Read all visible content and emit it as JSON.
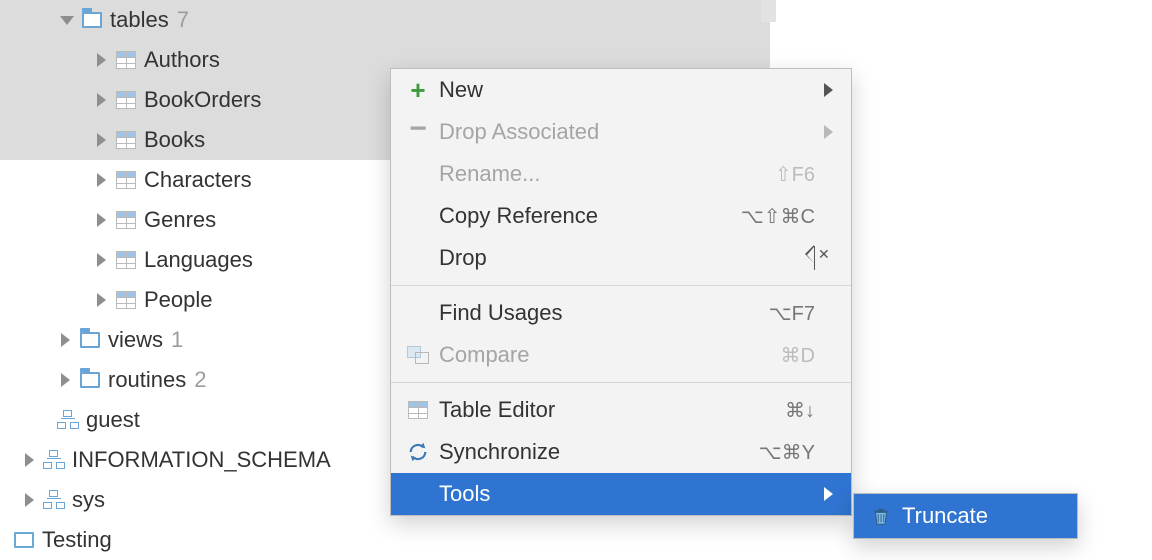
{
  "tree": {
    "tables_folder": {
      "label": "tables",
      "count": "7"
    },
    "items": [
      {
        "label": "Authors"
      },
      {
        "label": "BookOrders"
      },
      {
        "label": "Books"
      },
      {
        "label": "Characters"
      },
      {
        "label": "Genres"
      },
      {
        "label": "Languages"
      },
      {
        "label": "People"
      }
    ],
    "views_folder": {
      "label": "views",
      "count": "1"
    },
    "routines_folder": {
      "label": "routines",
      "count": "2"
    },
    "guest_schema": {
      "label": "guest"
    },
    "info_schema": {
      "label": "INFORMATION_SCHEMA"
    },
    "sys_schema": {
      "label": "sys"
    },
    "datasource": {
      "label": "Testing"
    }
  },
  "menu": {
    "new": {
      "label": "New"
    },
    "drop_assoc": {
      "label": "Drop Associated"
    },
    "rename": {
      "label": "Rename...",
      "accel": "⇧F6"
    },
    "copy_ref": {
      "label": "Copy Reference",
      "accel": "⌥⇧⌘C"
    },
    "drop": {
      "label": "Drop"
    },
    "find_usages": {
      "label": "Find Usages",
      "accel": "⌥F7"
    },
    "compare": {
      "label": "Compare",
      "accel": "⌘D"
    },
    "table_editor": {
      "label": "Table Editor",
      "accel": "⌘↓"
    },
    "synchronize": {
      "label": "Synchronize",
      "accel": "⌥⌘Y"
    },
    "tools": {
      "label": "Tools"
    }
  },
  "submenu": {
    "truncate": {
      "label": "Truncate"
    }
  }
}
